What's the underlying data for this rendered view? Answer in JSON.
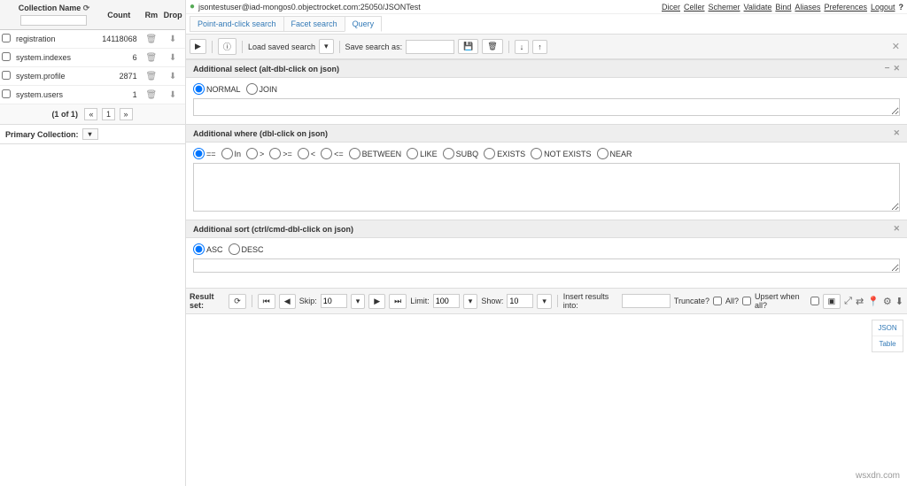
{
  "sidebar": {
    "headers": {
      "name": "Collection Name",
      "count": "Count",
      "rm": "Rm",
      "drop": "Drop"
    },
    "rows": [
      {
        "name": "registration",
        "count": "14118068"
      },
      {
        "name": "system.indexes",
        "count": "6"
      },
      {
        "name": "system.profile",
        "count": "2871"
      },
      {
        "name": "system.users",
        "count": "1"
      }
    ],
    "pagination_info": "(1 of 1)",
    "page_current": "1",
    "primary_label": "Primary Collection:"
  },
  "topbar": {
    "breadcrumb": "jsontestuser@iad-mongos0.objectrocket.com:25050/JSONTest",
    "links": [
      "Dicer",
      "Celler",
      "Schemer",
      "Validate",
      "Bind",
      "Aliases",
      "Preferences",
      "Logout"
    ],
    "help": "?"
  },
  "tabs": [
    "Point-and-click search",
    "Facet search",
    "Query"
  ],
  "toolbar": {
    "load_label": "Load saved search",
    "save_label": "Save search as:"
  },
  "panels": {
    "select": {
      "title": "Additional select (alt-dbl-click on json)",
      "options": [
        "NORMAL",
        "JOIN"
      ]
    },
    "where": {
      "title": "Additional where (dbl-click on json)",
      "options": [
        "==",
        "In",
        ">",
        ">=",
        "<",
        "<=",
        "BETWEEN",
        "LIKE",
        "SUBQ",
        "EXISTS",
        "NOT EXISTS",
        "NEAR"
      ]
    },
    "sort": {
      "title": "Additional sort (ctrl/cmd-dbl-click on json)",
      "options": [
        "ASC",
        "DESC"
      ]
    }
  },
  "resultbar": {
    "label": "Result set:",
    "skip_label": "Skip:",
    "skip_value": "10",
    "limit_label": "Limit:",
    "limit_value": "100",
    "show_label": "Show:",
    "show_value": "10",
    "insert_label": "Insert results into:",
    "truncate_label": "Truncate?",
    "all_label": "All?",
    "upsert_label": "Upsert when all?"
  },
  "view_tabs": [
    "JSON",
    "Table"
  ],
  "watermark": "wsxdn.com"
}
